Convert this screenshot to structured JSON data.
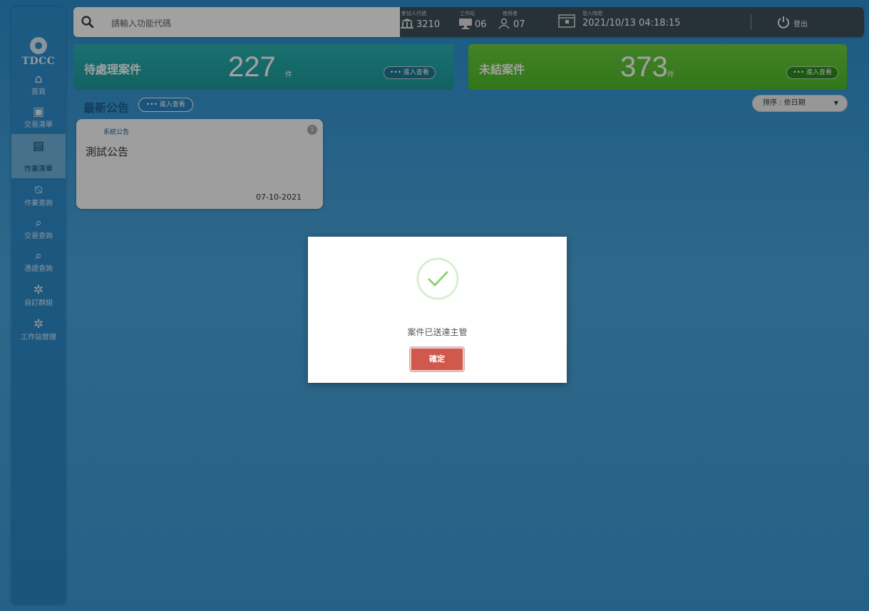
{
  "sidebar": {
    "logo_text": "TDCC",
    "items": [
      {
        "label": "首頁",
        "icon": "home-icon"
      },
      {
        "label": "交易清單",
        "icon": "transaction-list-icon"
      },
      {
        "label": "作業清單",
        "icon": "task-list-icon"
      },
      {
        "label": "作業查詢",
        "icon": "task-search-icon"
      },
      {
        "label": "交易查詢",
        "icon": "transaction-search-icon"
      },
      {
        "label": "憑證查詢",
        "icon": "certificate-search-icon"
      },
      {
        "label": "自訂群組",
        "icon": "group-icon"
      },
      {
        "label": "工作站管理",
        "icon": "workstation-icon"
      }
    ]
  },
  "topbar": {
    "search_placeholder": "請輸入功能代碼",
    "participant": {
      "label": "參加人代號",
      "value": "3210"
    },
    "workstation": {
      "label": "工作站",
      "value": "06"
    },
    "user": {
      "label": "使用者",
      "value": "07"
    },
    "login_time": {
      "label": "登入時間",
      "value": "2021/10/13 04:18:15"
    },
    "logout_label": "登出"
  },
  "cards": {
    "pending": {
      "title": "待處理案件",
      "count": "227",
      "unit": "件",
      "action": "••• 進入查看"
    },
    "open": {
      "title": "未結案件",
      "count": "373",
      "unit": "件",
      "action": "••• 進入查看"
    }
  },
  "announcements": {
    "title": "最新公告",
    "action": "••• 進入查看",
    "sort_label": "排序 : 依日期",
    "items": [
      {
        "category": "系統公告",
        "title": "測試公告",
        "date": "07-10-2021",
        "badge": "1"
      }
    ]
  },
  "modal": {
    "message": "案件已送達主管",
    "confirm_label": "確定"
  },
  "colors": {
    "pending_card": "#22a6a6",
    "open_card": "#5cc433",
    "confirm_button": "#d1584d",
    "check_green": "#8ed07a"
  }
}
